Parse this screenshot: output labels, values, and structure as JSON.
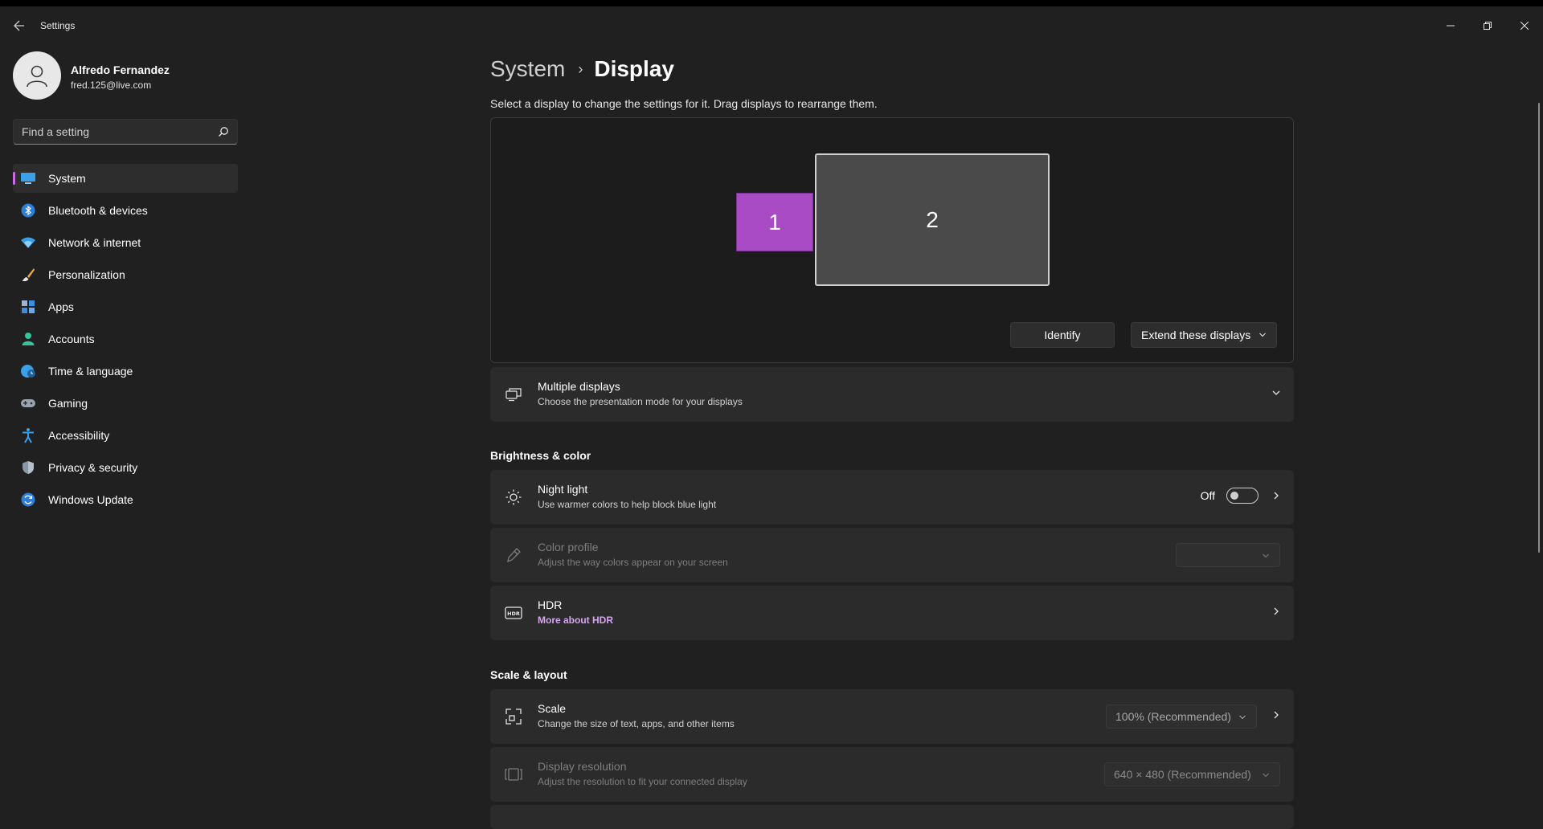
{
  "window": {
    "title": "Settings"
  },
  "user": {
    "name": "Alfredo Fernandez",
    "email": "fred.125@live.com"
  },
  "search": {
    "placeholder": "Find a setting"
  },
  "sidebar": {
    "items": [
      {
        "label": "System",
        "icon": "system-icon",
        "active": true
      },
      {
        "label": "Bluetooth & devices",
        "icon": "bluetooth-icon"
      },
      {
        "label": "Network & internet",
        "icon": "wifi-icon"
      },
      {
        "label": "Personalization",
        "icon": "brush-icon"
      },
      {
        "label": "Apps",
        "icon": "apps-icon"
      },
      {
        "label": "Accounts",
        "icon": "accounts-icon"
      },
      {
        "label": "Time & language",
        "icon": "globe-clock-icon"
      },
      {
        "label": "Gaming",
        "icon": "gamepad-icon"
      },
      {
        "label": "Accessibility",
        "icon": "accessibility-icon"
      },
      {
        "label": "Privacy & security",
        "icon": "shield-icon"
      },
      {
        "label": "Windows Update",
        "icon": "update-icon"
      }
    ]
  },
  "breadcrumb": {
    "parent": "System",
    "separator": "›",
    "current": "Display"
  },
  "display": {
    "hint": "Select a display to change the settings for it. Drag displays to rearrange them.",
    "monitor1": "1",
    "monitor2": "2",
    "identify_label": "Identify",
    "mode_label": "Extend these displays"
  },
  "multiple_displays": {
    "title": "Multiple displays",
    "subtitle": "Choose the presentation mode for your displays"
  },
  "brightness": {
    "heading": "Brightness & color",
    "night_light": {
      "title": "Night light",
      "subtitle": "Use warmer colors to help block blue light",
      "state": "Off"
    },
    "color_profile": {
      "title": "Color profile",
      "subtitle": "Adjust the way colors appear on your screen"
    },
    "hdr": {
      "title": "HDR",
      "link": "More about HDR"
    }
  },
  "scale_layout": {
    "heading": "Scale & layout",
    "scale": {
      "title": "Scale",
      "subtitle": "Change the size of text, apps, and other items",
      "value": "100% (Recommended)"
    },
    "resolution": {
      "title": "Display resolution",
      "subtitle": "Adjust the resolution to fit your connected display",
      "value": "640 × 480 (Recommended)"
    }
  },
  "colors": {
    "accent": "#c86ee0",
    "monitor1": "#a94bc4",
    "link": "#d6a5f0"
  }
}
